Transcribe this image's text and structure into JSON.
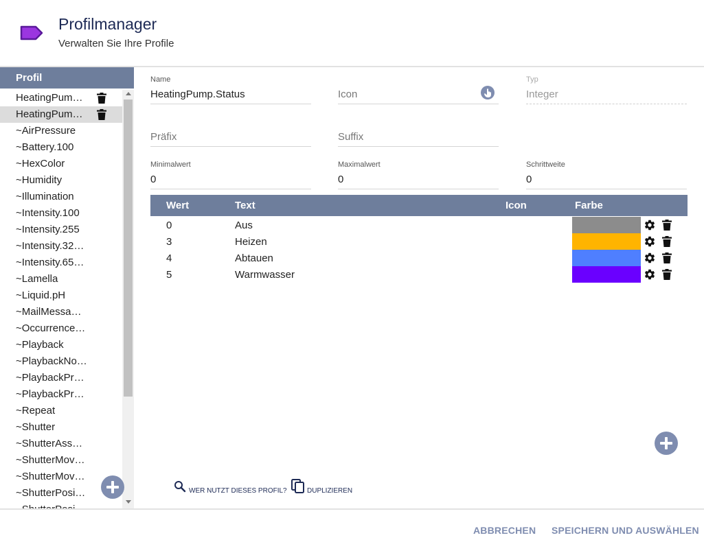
{
  "header": {
    "icon": "tag-icon",
    "title": "Profilmanager",
    "subtitle": "Verwalten Sie Ihre Profile",
    "accent_color": "#9b36e0"
  },
  "sidebar": {
    "header": "Profil",
    "items": [
      {
        "label": "HeatingPum…",
        "deletable": true,
        "selected": false
      },
      {
        "label": "HeatingPum…",
        "deletable": true,
        "selected": true
      },
      {
        "label": "~AirPressure"
      },
      {
        "label": "~Battery.100"
      },
      {
        "label": "~HexColor"
      },
      {
        "label": "~Humidity"
      },
      {
        "label": "~Illumination"
      },
      {
        "label": "~Intensity.100"
      },
      {
        "label": "~Intensity.255"
      },
      {
        "label": "~Intensity.32…"
      },
      {
        "label": "~Intensity.65…"
      },
      {
        "label": "~Lamella"
      },
      {
        "label": "~Liquid.pH"
      },
      {
        "label": "~MailMessa…"
      },
      {
        "label": "~Occurrence…"
      },
      {
        "label": "~Playback"
      },
      {
        "label": "~PlaybackNo…"
      },
      {
        "label": "~PlaybackPr…"
      },
      {
        "label": "~PlaybackPr…"
      },
      {
        "label": "~Repeat"
      },
      {
        "label": "~Shutter"
      },
      {
        "label": "~ShutterAss…"
      },
      {
        "label": "~ShutterMov…"
      },
      {
        "label": "~ShutterMov…"
      },
      {
        "label": "~ShutterPosi…"
      },
      {
        "label": "~ShutterPosi…"
      }
    ]
  },
  "form": {
    "name": {
      "label": "Name",
      "value": "HeatingPump.Status"
    },
    "icon": {
      "placeholder": "Icon"
    },
    "typ": {
      "label": "Typ",
      "value": "Integer"
    },
    "prefix": {
      "placeholder": "Präfix"
    },
    "suffix": {
      "placeholder": "Suffix"
    },
    "min": {
      "label": "Minimalwert",
      "value": "0"
    },
    "max": {
      "label": "Maximalwert",
      "value": "0"
    },
    "step": {
      "label": "Schrittweite",
      "value": "0"
    }
  },
  "table": {
    "headers": {
      "wert": "Wert",
      "text": "Text",
      "icon": "Icon",
      "farbe": "Farbe"
    },
    "rows": [
      {
        "wert": "0",
        "text": "Aus",
        "color": "#8c8c8c"
      },
      {
        "wert": "3",
        "text": "Heizen",
        "color": "#ffb400"
      },
      {
        "wert": "4",
        "text": "Abtauen",
        "color": "#4f7fff"
      },
      {
        "wert": "5",
        "text": "Warmwasser",
        "color": "#6a00ff"
      }
    ]
  },
  "actions": {
    "who_uses": "Wer nutzt dieses Profil?",
    "duplicate": "Duplizieren"
  },
  "footer": {
    "cancel": "ABBRECHEN",
    "save": "SPEICHERN UND AUSWÄHLEN"
  }
}
